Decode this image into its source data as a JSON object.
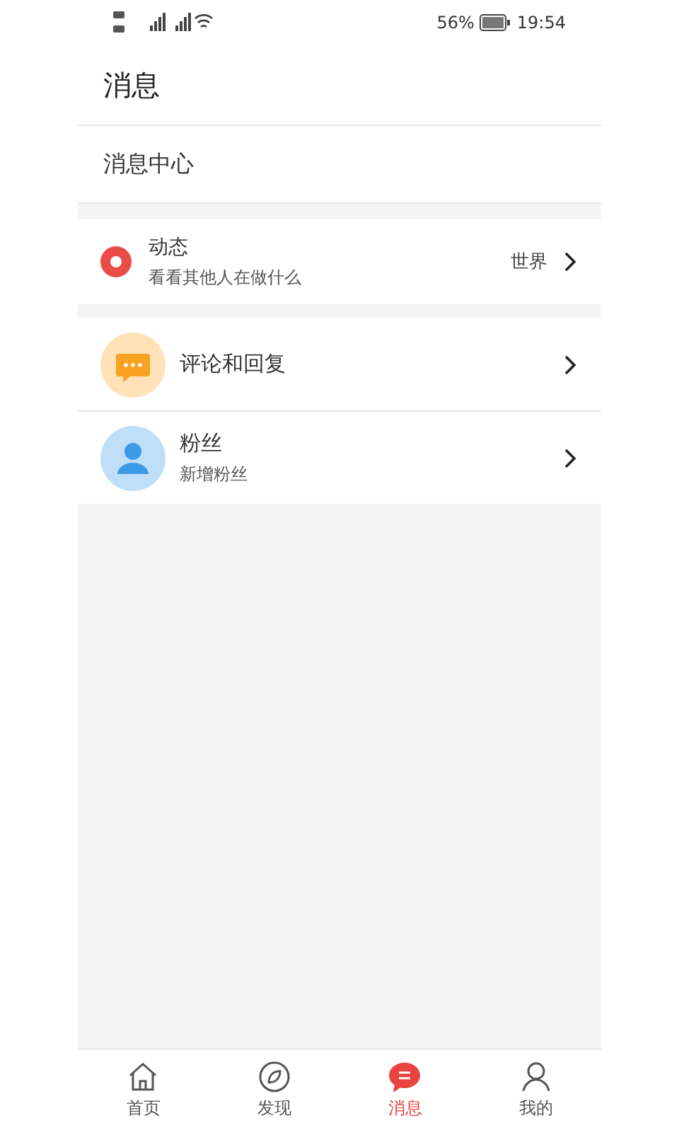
{
  "status_bar": {
    "battery": "56%",
    "time": "19:54"
  },
  "header": {
    "title": "消息"
  },
  "section": {
    "title": "消息中心"
  },
  "groups": [
    {
      "items": [
        {
          "kind": "record",
          "title": "动态",
          "subtitle": "看看其他人在做什么",
          "value": "世界"
        }
      ]
    },
    {
      "items": [
        {
          "kind": "comment",
          "title": "评论和回复"
        },
        {
          "kind": "fans",
          "title": "粉丝",
          "subtitle": "新增粉丝"
        }
      ]
    }
  ],
  "tabs": [
    {
      "kind": "home",
      "label": "首页",
      "selected": false
    },
    {
      "kind": "discover",
      "label": "发现",
      "selected": false
    },
    {
      "kind": "message",
      "label": "消息",
      "selected": true
    },
    {
      "kind": "me",
      "label": "我的",
      "selected": false
    }
  ]
}
